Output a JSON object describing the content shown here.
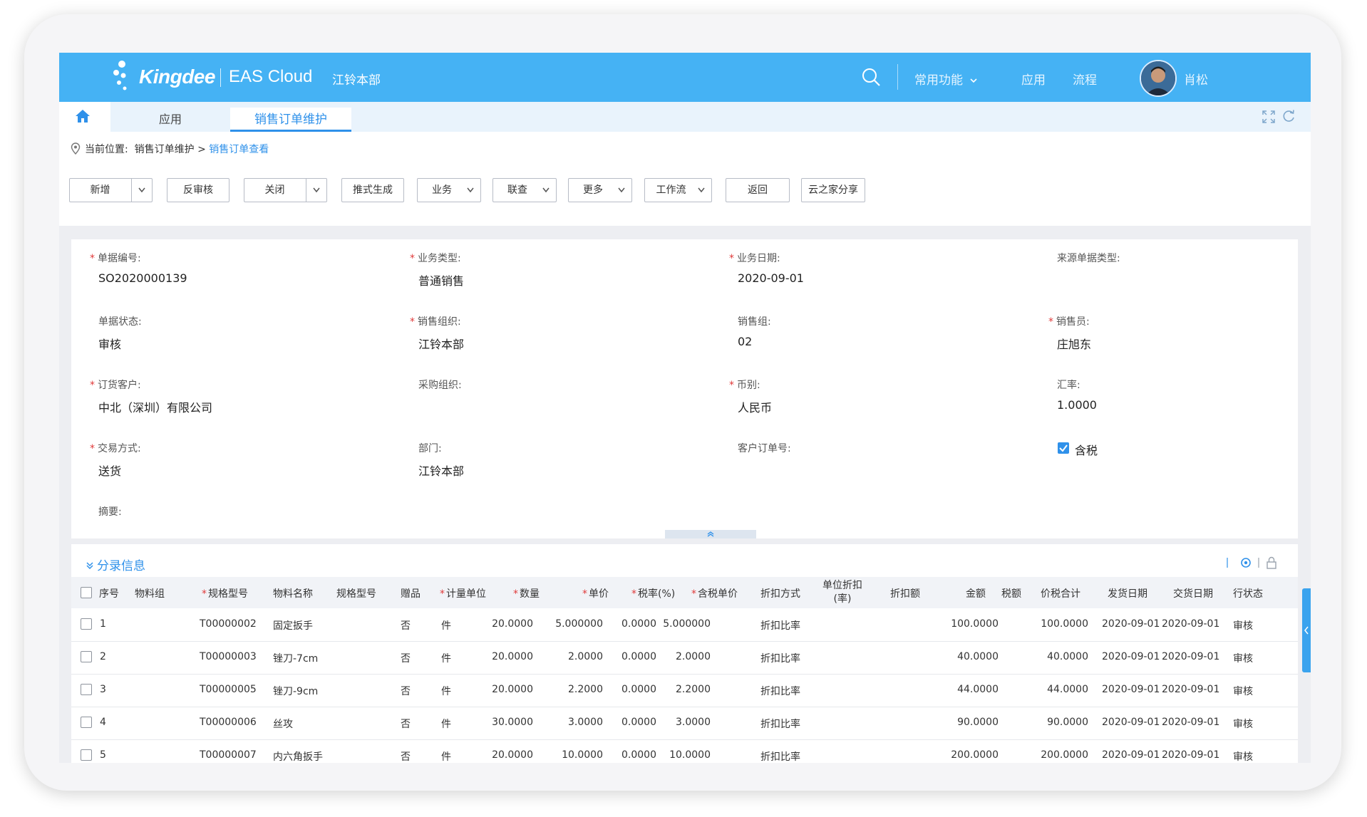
{
  "topbar": {
    "brand": "Kingdee",
    "product": "EAS Cloud",
    "org": "江铃本部",
    "common_menu": "常用功能",
    "apps": "应用",
    "flow": "流程",
    "user_name": "肖松",
    "bg_color": "#45b2f4"
  },
  "tabs": {
    "apps": "应用",
    "active": "销售订单维护"
  },
  "breadcrumb": {
    "prefix": "当前位置:",
    "parent": "销售订单维护",
    "sep": ">",
    "current": "销售订单查看"
  },
  "toolbar": {
    "add": "新增",
    "unaudit": "反审核",
    "close": "关闭",
    "push": "推式生成",
    "business": "业务",
    "linked": "联查",
    "more": "更多",
    "workflow": "工作流",
    "back": "返回",
    "share": "云之家分享"
  },
  "header": {
    "bill_no": {
      "label": "单据编号:",
      "value": "SO2020000139"
    },
    "biz_type": {
      "label": "业务类型:",
      "value": "普通销售"
    },
    "biz_date": {
      "label": "业务日期:",
      "value": "2020-09-01"
    },
    "source_type": {
      "label": "来源单据类型:",
      "value": ""
    },
    "status": {
      "label": "单据状态:",
      "value": "审核"
    },
    "sale_org": {
      "label": "销售组织:",
      "value": "江铃本部"
    },
    "sale_group": {
      "label": "销售组:",
      "value": "02"
    },
    "salesman": {
      "label": "销售员:",
      "value": "庄旭东"
    },
    "customer": {
      "label": "订货客户:",
      "value": "中北（深圳）有限公司"
    },
    "purchase_org": {
      "label": "采购组织:",
      "value": ""
    },
    "currency": {
      "label": "币别:",
      "value": "人民币"
    },
    "rate": {
      "label": "汇率:",
      "value": "1.0000"
    },
    "trade_mode": {
      "label": "交易方式:",
      "value": "送货"
    },
    "dept": {
      "label": "部门:",
      "value": "江铃本部"
    },
    "cust_order": {
      "label": "客户订单号:",
      "value": ""
    },
    "tax_included": {
      "label": "含税",
      "checked": true
    },
    "memo": {
      "label": "摘要:",
      "value": ""
    }
  },
  "entry": {
    "title": "分录信息",
    "columns": {
      "seq": "序号",
      "group": "物料组",
      "spec": "规格型号",
      "name": "物料名称",
      "spec2": "规格型号",
      "gift": "赠品",
      "unit": "计量单位",
      "qty": "数量",
      "price": "单价",
      "tax_rate": "税率(%)",
      "tax_price": "含税单价",
      "disc_mode": "折扣方式",
      "unit_disc_1": "单位折扣",
      "unit_disc_2": "(率)",
      "disc_amt": "折扣额",
      "amount": "金额",
      "tax": "税额",
      "total": "价税合计",
      "ship_date": "发货日期",
      "deliv_date": "交货日期",
      "row_status": "行状态"
    },
    "rows": [
      {
        "seq": "1",
        "spec": "T00000002",
        "name": "固定扳手",
        "gift": "否",
        "unit": "件",
        "qty": "20.0000",
        "price": "5.000000",
        "tax_rate": "0.0000",
        "tax_price": "5.000000",
        "disc_mode": "折扣比率",
        "amount": "100.0000",
        "total": "100.0000",
        "ship_date": "2020-09-01",
        "deliv_date": "2020-09-01",
        "row_status": "审核"
      },
      {
        "seq": "2",
        "spec": "T00000003",
        "name": "锉刀-7cm",
        "gift": "否",
        "unit": "件",
        "qty": "20.0000",
        "price": "2.0000",
        "tax_rate": "0.0000",
        "tax_price": "2.0000",
        "disc_mode": "折扣比率",
        "amount": "40.0000",
        "total": "40.0000",
        "ship_date": "2020-09-01",
        "deliv_date": "2020-09-01",
        "row_status": "审核"
      },
      {
        "seq": "3",
        "spec": "T00000005",
        "name": "锉刀-9cm",
        "gift": "否",
        "unit": "件",
        "qty": "20.0000",
        "price": "2.2000",
        "tax_rate": "0.0000",
        "tax_price": "2.2000",
        "disc_mode": "折扣比率",
        "amount": "44.0000",
        "total": "44.0000",
        "ship_date": "2020-09-01",
        "deliv_date": "2020-09-01",
        "row_status": "审核"
      },
      {
        "seq": "4",
        "spec": "T00000006",
        "name": "丝攻",
        "gift": "否",
        "unit": "件",
        "qty": "30.0000",
        "price": "3.0000",
        "tax_rate": "0.0000",
        "tax_price": "3.0000",
        "disc_mode": "折扣比率",
        "amount": "90.0000",
        "total": "90.0000",
        "ship_date": "2020-09-01",
        "deliv_date": "2020-09-01",
        "row_status": "审核"
      },
      {
        "seq": "5",
        "spec": "T00000007",
        "name": "内六角扳手",
        "gift": "否",
        "unit": "件",
        "qty": "20.0000",
        "price": "10.0000",
        "tax_rate": "0.0000",
        "tax_price": "10.0000",
        "disc_mode": "折扣比率",
        "amount": "200.0000",
        "total": "200.0000",
        "ship_date": "2020-09-01",
        "deliv_date": "2020-09-01",
        "row_status": "审核"
      }
    ]
  },
  "icons": [
    "kingdee-logo-icon",
    "search-icon",
    "chevron-down-icon",
    "home-icon",
    "expand-icon",
    "refresh-icon",
    "location-pin-icon",
    "collapse-up-icon",
    "settings-icon",
    "lock-icon",
    "check-icon"
  ],
  "colors": {
    "accent": "#2f91ea",
    "required": "#e03a3a"
  }
}
